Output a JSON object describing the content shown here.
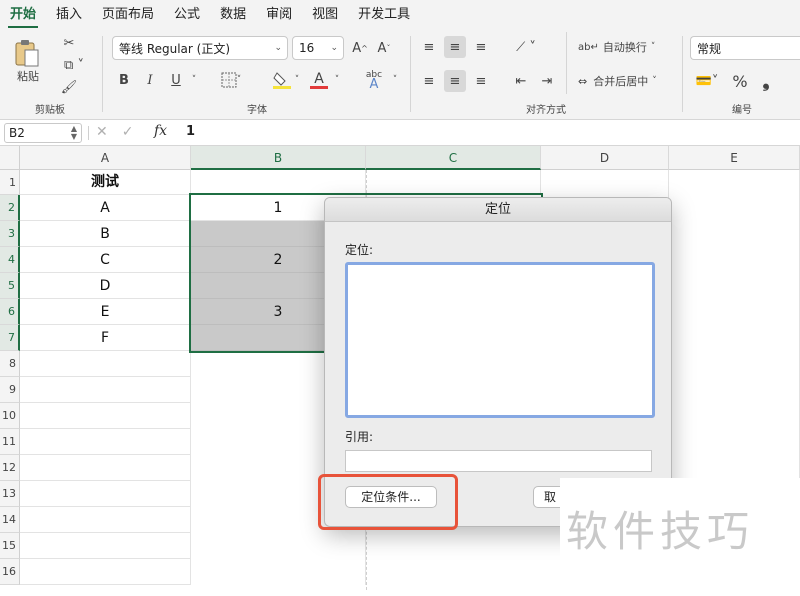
{
  "tabs": [
    "开始",
    "插入",
    "页面布局",
    "公式",
    "数据",
    "审阅",
    "视图",
    "开发工具"
  ],
  "ribbon": {
    "clipboard": {
      "paste_label": "粘贴",
      "group_label": "剪贴板"
    },
    "font": {
      "family": "等线 Regular (正文)",
      "size": "16",
      "bold": "B",
      "italic": "I",
      "underline": "U",
      "grow": "A^",
      "shrink": "Aˇ",
      "color_glyph": "A",
      "phonetic": "abc",
      "group_label": "字体"
    },
    "alignment": {
      "wrap_label": "自动换行",
      "merge_label": "合并后居中",
      "group_label": "对齐方式"
    },
    "number": {
      "format": "常规",
      "percent": "%",
      "comma": "❟",
      "group_label": "编号"
    }
  },
  "formula_bar": {
    "name_box": "B2",
    "fx": "fx",
    "value": "1"
  },
  "columns": [
    "A",
    "B",
    "C",
    "D",
    "E"
  ],
  "rows": [
    "1",
    "2",
    "3",
    "4",
    "5",
    "6",
    "7",
    "8",
    "9",
    "10",
    "11",
    "12",
    "13",
    "14",
    "15",
    "16"
  ],
  "cells": {
    "A1": "测试",
    "A2": "A",
    "A3": "B",
    "A4": "C",
    "A5": "D",
    "A6": "E",
    "A7": "F",
    "B2": "1",
    "B4": "2",
    "B6": "3"
  },
  "dialog": {
    "title": "定位",
    "goto_label": "定位:",
    "reference_label": "引用:",
    "reference_value": "",
    "special_button": "定位条件...",
    "cancel_button": "取"
  },
  "watermark": "软件技巧",
  "colors": {
    "accent": "#1f6e43",
    "highlight": "#e8533a",
    "selected_cell": "#c9c9c9"
  }
}
